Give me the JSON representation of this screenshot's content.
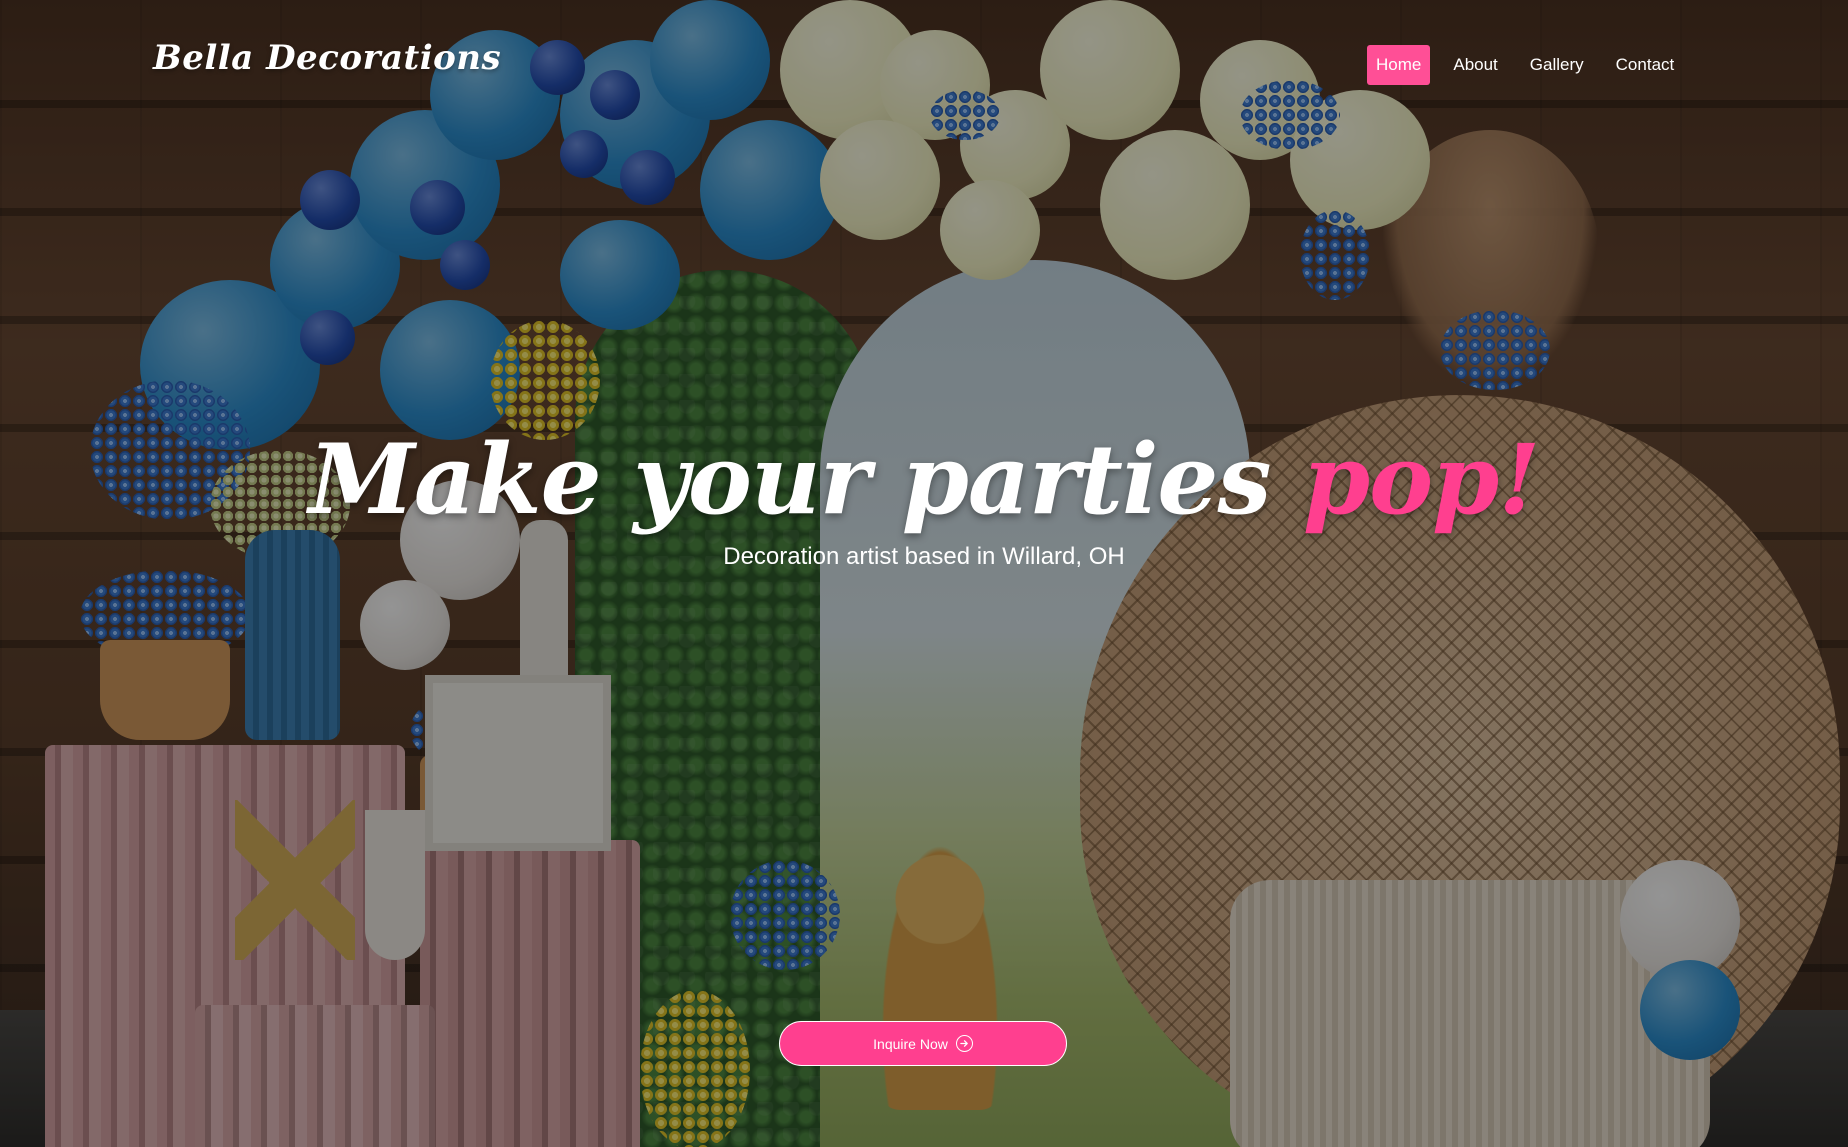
{
  "brand": {
    "name": "Bella Decorations"
  },
  "nav": {
    "items": [
      {
        "label": "Home",
        "active": true
      },
      {
        "label": "About",
        "active": false
      },
      {
        "label": "Gallery",
        "active": false
      },
      {
        "label": "Contact",
        "active": false
      }
    ]
  },
  "hero": {
    "headline_main": "Make your parties",
    "headline_accent": "pop!",
    "subheadline": "Decoration artist based in Willard, OH",
    "cta_label": "Inquire Now",
    "cta_icon": "arrow-right-circle-icon"
  },
  "colors": {
    "accent": "#ff3f8f",
    "nav_active_bg": "#ff4f96",
    "text": "#ffffff"
  }
}
